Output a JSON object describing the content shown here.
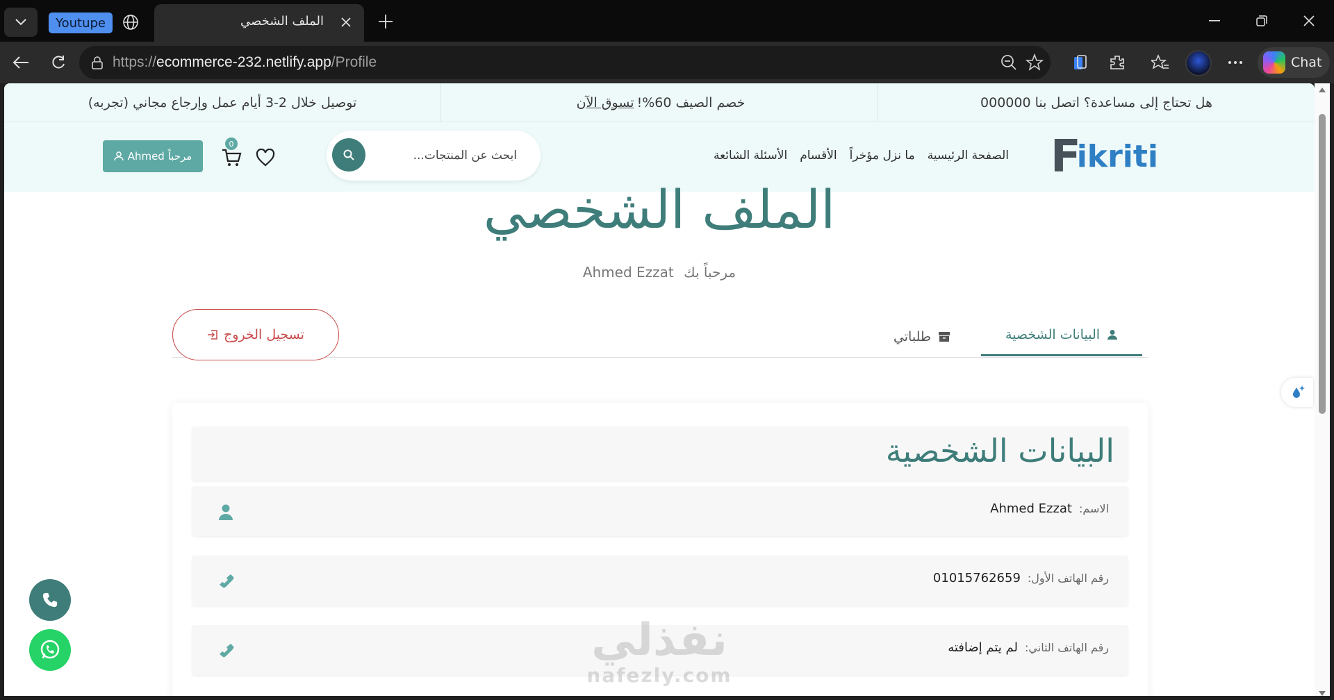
{
  "browser": {
    "tab_group_label": "Youtupe",
    "active_tab_title": "الملف الشخصي",
    "url_scheme": "https://",
    "url_host": "ecommerce-232.netlify.app",
    "url_path": "/Profile",
    "chat_label": "Chat"
  },
  "announcement": {
    "help": "هل تحتاج إلى مساعدة؟ اتصل بنا 000000",
    "promo_text": "خصم الصيف 60%!",
    "promo_link": "تسوق الآن",
    "delivery": "توصيل خلال 2-3 أيام عمل وإرجاع مجاني (تجربه)"
  },
  "nav": {
    "logo_first": "F",
    "logo_rest": "ikriti",
    "links": [
      "الصفحة الرئيسية",
      "ما نزل مؤخراً",
      "الأقسام",
      "الأسئلة الشائعة"
    ],
    "search_placeholder": "ابحث عن المنتجات...",
    "cart_count": "0",
    "greeting": "مرحباً Ahmed"
  },
  "profile": {
    "title": "الملف الشخصي",
    "welcome_prefix": "مرحباً بك",
    "user_name": "Ahmed Ezzat",
    "tab_personal": "البيانات الشخصية",
    "tab_orders": "طلباتي",
    "logout": "تسجيل الخروج",
    "card_title": "البيانات الشخصية",
    "fields": [
      {
        "label": "الاسم:",
        "value": "Ahmed Ezzat"
      },
      {
        "label": "رقم الهاتف الأول:",
        "value": "01015762659"
      },
      {
        "label": "رقم الهاتف الثاني:",
        "value": "لم يتم إضافته"
      }
    ]
  },
  "watermark": {
    "arabic": "نفذلي",
    "latin": "nafezly.com"
  },
  "colors": {
    "brand_teal": "#3e7d7a",
    "accent_teal": "#5ea9a4",
    "logout_red": "#c94a4a",
    "whatsapp_green": "#25d366"
  }
}
